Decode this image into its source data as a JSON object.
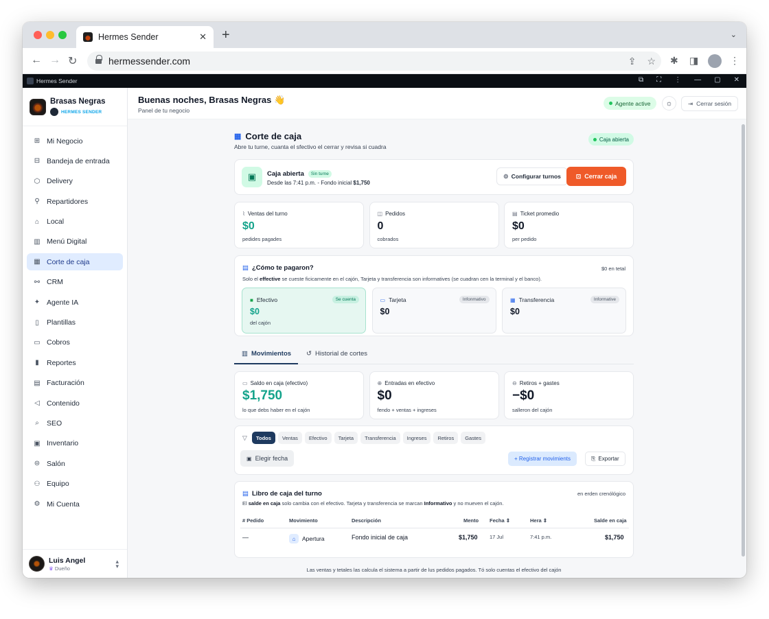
{
  "browser": {
    "tab_title": "Hermes Sender",
    "url": "hermessender.com"
  },
  "app_title": "Hermes Sender",
  "sidebar": {
    "brand_name": "Brasas Negras",
    "brand_sub": "HERMES SENDER",
    "items": [
      {
        "label": "Mi Negocio",
        "icon": "grid-icon"
      },
      {
        "label": "Bandeja de entrada",
        "icon": "inbox-icon"
      },
      {
        "label": "Delivery",
        "icon": "box-icon"
      },
      {
        "label": "Repartidores",
        "icon": "bike-icon"
      },
      {
        "label": "Local",
        "icon": "store-icon"
      },
      {
        "label": "Menú Digital",
        "icon": "book-icon"
      },
      {
        "label": "Corte de caja",
        "icon": "register-icon",
        "active": true
      },
      {
        "label": "CRM",
        "icon": "people-icon"
      },
      {
        "label": "Agente IA",
        "icon": "sparkle-icon"
      },
      {
        "label": "Plantillas",
        "icon": "file-icon"
      },
      {
        "label": "Cobros",
        "icon": "card-icon"
      },
      {
        "label": "Reportes",
        "icon": "bars-icon"
      },
      {
        "label": "Facturación",
        "icon": "receipt-icon"
      },
      {
        "label": "Contenido",
        "icon": "megaphone-icon"
      },
      {
        "label": "SEO",
        "icon": "search-icon"
      },
      {
        "label": "Inventario",
        "icon": "warehouse-icon"
      },
      {
        "label": "Salón",
        "icon": "table-icon"
      },
      {
        "label": "Equipo",
        "icon": "team-icon"
      },
      {
        "label": "Mi Cuenta",
        "icon": "gear-icon"
      }
    ],
    "user": {
      "name": "Luis Angel",
      "role": "Dueño"
    }
  },
  "header": {
    "greeting": "Buenas noches, Brasas Negras 👋",
    "subtitle": "Panel de tu negocio",
    "agent_status": "Agente active",
    "logout": "Cerrar sesión"
  },
  "page": {
    "title": "Corte de caja",
    "subtitle": "Abre tu turne, cuanta el sfectivo el cerrar y revisa si cuadra",
    "status_pill": "Caja abierta"
  },
  "open_card": {
    "title": "Caja abierta",
    "badge": "Sin turne",
    "since_prefix": "Desde las 7:41 p.m. - Fondo inicial ",
    "fund": "$1,750",
    "config_label": "Configurar turnos",
    "close_label": "Cerrar caja"
  },
  "stats": [
    {
      "label": "Ventas del turno",
      "value": "$0",
      "foot": "pedides pagades",
      "icon": "chart-icon"
    },
    {
      "label": "Pedidos",
      "value": "0",
      "foot": "cobrados",
      "icon": "bag-icon"
    },
    {
      "label": "Ticket promedio",
      "value": "$0",
      "foot": "per pedido",
      "icon": "ticket-icon"
    }
  ],
  "payments": {
    "title": "¿Cómo te pagaron?",
    "total": "$0 en tetal",
    "note_prefix": "Solo el ",
    "note_bold": "effective",
    "note_suffix": " se cueste ficicamente en el cajón, Tarjeta y transferencia son informatives (se cuadran cen la terminal y el banco).",
    "methods": [
      {
        "name": "Efectivo",
        "badge": "Se cuenta",
        "value": "$0",
        "foot": "del cajón",
        "icon": "cash-icon"
      },
      {
        "name": "Tarjeta",
        "badge": "Infonmativo",
        "value": "$0",
        "foot": "",
        "icon": "card-icon"
      },
      {
        "name": "Transferencia",
        "badge": "Informative",
        "value": "$0",
        "foot": "",
        "icon": "bank-icon"
      }
    ]
  },
  "tabs": {
    "movimientos": "Movimientos",
    "historial": "Historial de cortes"
  },
  "movements": [
    {
      "label": "Saldo en caja (efectivo)",
      "value": "$1,750",
      "foot": "lo que debs haber en el cajón",
      "icon": "wallet-icon"
    },
    {
      "label": "Entradas en efectivo",
      "value": "$0",
      "foot": "fendo + ventas + ingreses",
      "icon": "in-icon"
    },
    {
      "label": "Retiros + gastes",
      "value": "−$0",
      "foot": "salleron del cajón",
      "icon": "out-icon"
    }
  ],
  "filters": {
    "chips": [
      "Todos",
      "Ventas",
      "Efectivo",
      "Tarjeta",
      "Transferencia",
      "Ingreses",
      "Retiros",
      "Gastes"
    ],
    "date_label": "Elegir fecha",
    "register_label": "+ Registrar movimients",
    "export_label": "Exportar"
  },
  "ledger": {
    "title": "Libro de caja del turno",
    "order": "en erden crenólógico",
    "note_p1": "El ",
    "note_b1": "salde en caja",
    "note_p2": " solo cambia con el efectivo. Tarjeta y transferencia se marcan ",
    "note_b2": "Informativo",
    "note_p3": " y no mueven el cajón.",
    "columns": [
      "# Pedido",
      "Movimiento",
      "Descripción",
      "Mento",
      "Fecha ⇕",
      "Hera ⇕",
      "Salde en caja"
    ],
    "rows": [
      {
        "pedido": "—",
        "movimiento": "Apertura",
        "descripcion": "Fondo inicial de caja",
        "monto": "$1,750",
        "fecha": "17 Jul",
        "hora": "7:41 p.m.",
        "saldo": "$1,750"
      }
    ]
  },
  "footnote": "Las ventas y tetales las calcula el sistema a partir de lus pedidos pagados. Tó solo cuentas el efectivo del cajón"
}
